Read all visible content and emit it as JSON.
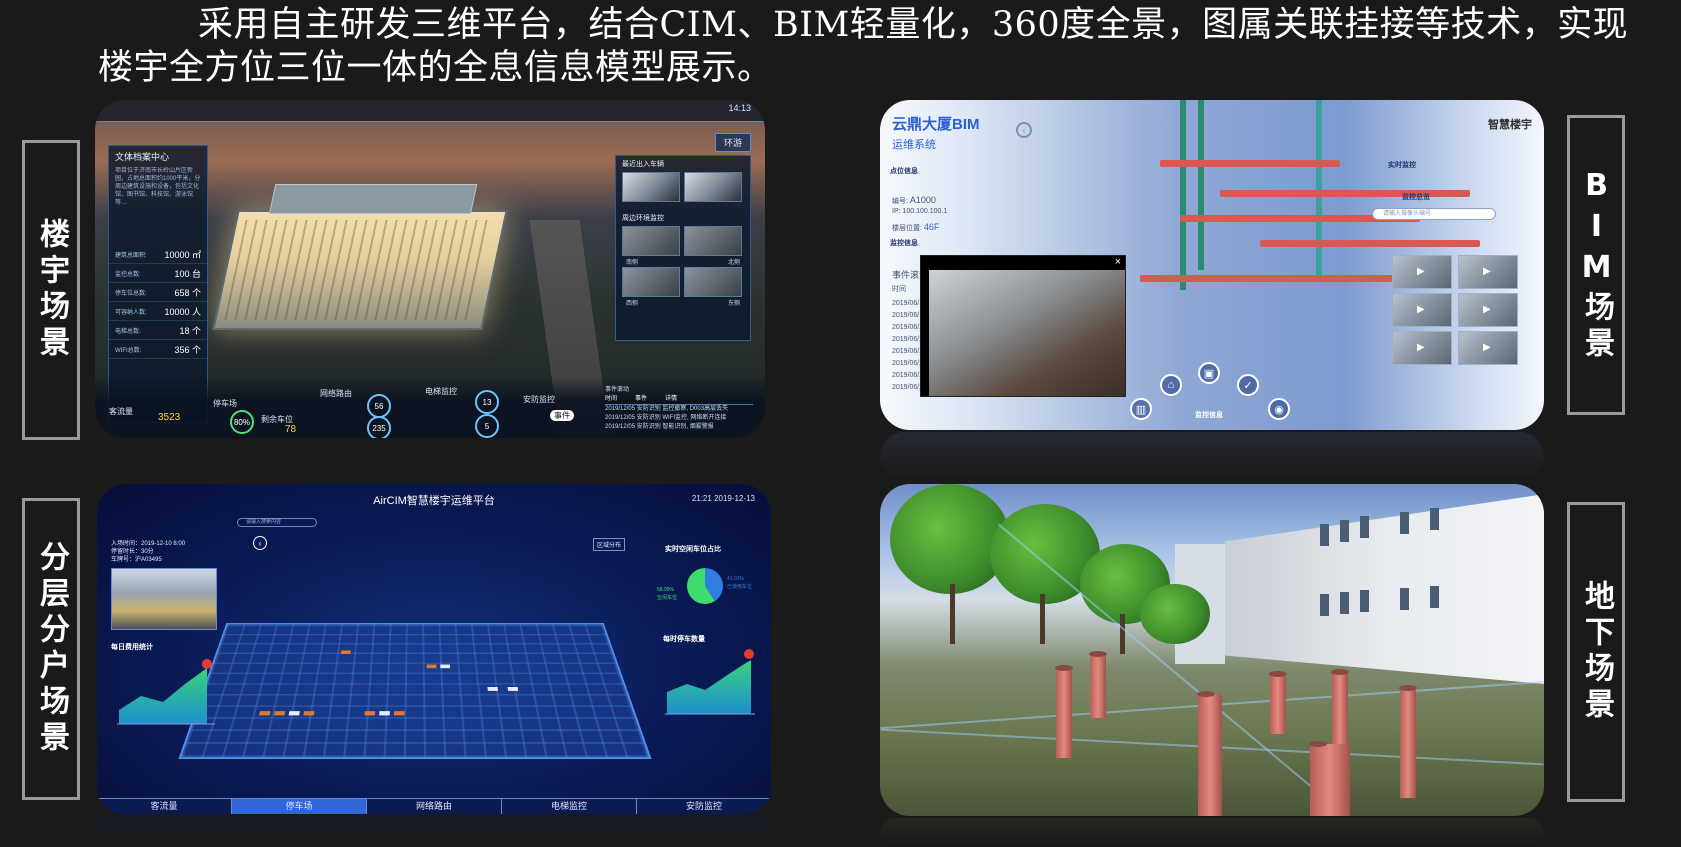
{
  "intro": {
    "text": "采用自主研发三维平台，结合CIM、BIM轻量化，360度全景，图属关联挂接等技术，实现楼宇全方位三位一体的全息信息模型展示。"
  },
  "labels": {
    "building_scene": "楼宇场景",
    "bim_scene": "BIM场景",
    "floor_scene": "分层分户场景",
    "underground_scene": "地下场景"
  },
  "panel1": {
    "time": "14:13",
    "tab": "环游",
    "left_title": "文体档案中心",
    "left_desc": "项目位于济南市长岭山片区新园，占地总面积约1000平米，分周边建筑设施和设备，包括文化馆、图书馆、科技馆、游泳馆等…",
    "stats": [
      {
        "name": "建筑总面积:",
        "value": "10000 ㎡"
      },
      {
        "name": "监控总数:",
        "value": "100 台"
      },
      {
        "name": "停车位总数:",
        "value": "658 个"
      },
      {
        "name": "可容纳人数:",
        "value": "10000 人"
      },
      {
        "name": "电梯总数:",
        "value": "18 个"
      },
      {
        "name": "WIFI总数:",
        "value": "356 个"
      }
    ],
    "right_title_1": "最近出入车辆",
    "right_title_2": "周边环境监控",
    "cam_caps": [
      "南侧",
      "北侧",
      "西侧",
      "东侧"
    ],
    "bottom": {
      "traffic_label": "客流量",
      "traffic_value": "3523",
      "parking_label": "停车场",
      "parking_pct": "80%",
      "parking_remain_label": "剩余车位",
      "parking_remain": "78",
      "network_label": "网络路由",
      "network_a": "56",
      "network_b": "235",
      "elevator_label": "电梯监控",
      "elevator_a": "13",
      "elevator_b": "5",
      "security_label": "安防监控",
      "security_btn": "事件",
      "events_title": "事件滚动",
      "events_head": [
        "时间",
        "事件",
        "详情"
      ],
      "events": [
        [
          "2019/12/05",
          "安防识别",
          "监控撤察, D003高层丢失"
        ],
        [
          "2019/12/05",
          "安防识别",
          "WIFI监控, 网络断开连接"
        ],
        [
          "2019/12/05",
          "安防识别",
          "智能识别, 烟雾警报"
        ]
      ]
    }
  },
  "panel2": {
    "title": "云鼎大厦BIM",
    "subtitle": "运维系统",
    "brand": "智慧楼宇",
    "point_info": "点位信息",
    "id_label": "编号:",
    "id_value": "A1000",
    "ip_label": "IP:",
    "ip_value": "100.100.100.1",
    "floor_label": "楼层位置:",
    "floor_value": "46F",
    "monitor_info": "监控信息",
    "event_label": "事件滚动",
    "time_label": "时间",
    "dates": [
      "2019/06/1",
      "2019/06/1",
      "2019/06/2",
      "2019/06/2",
      "2019/06/2",
      "2019/06/2",
      "2019/06/2",
      "2019/06/2"
    ],
    "realtime": "实时监控",
    "monitor_overview": "监控总览",
    "search_placeholder": "请输入摄像头编号",
    "bottom_label": "监控信息",
    "close": "×"
  },
  "panel3": {
    "title": "AirCIM智慧楼宇运维平台",
    "time": "21:21",
    "date": "2019-12-13",
    "search_placeholder": "请输入搜索内容",
    "entry_time": "入场时间：2019-12-10 8:00",
    "stay_time": "停留时长：30分",
    "plate": "车牌号：沪A03495",
    "region_btn": "区域分布",
    "chart_left_title": "每日费用统计",
    "chart_right_title": "每时停车数量",
    "pie_title": "实时空闲车位占比",
    "pie_a": "41.01%",
    "pie_a_label": "已使用车位",
    "pie_b": "58.99%",
    "pie_b_label": "空闲车位",
    "tabs": [
      "客流量",
      "停车场",
      "网络路由",
      "电梯监控",
      "安防监控"
    ],
    "active_tab": 1
  },
  "colors": {
    "accent_blue": "#2d5fd6",
    "active_tab": "#2f66d8",
    "pipe_red": "#d75a52",
    "label_border": "#9a9a9a"
  }
}
